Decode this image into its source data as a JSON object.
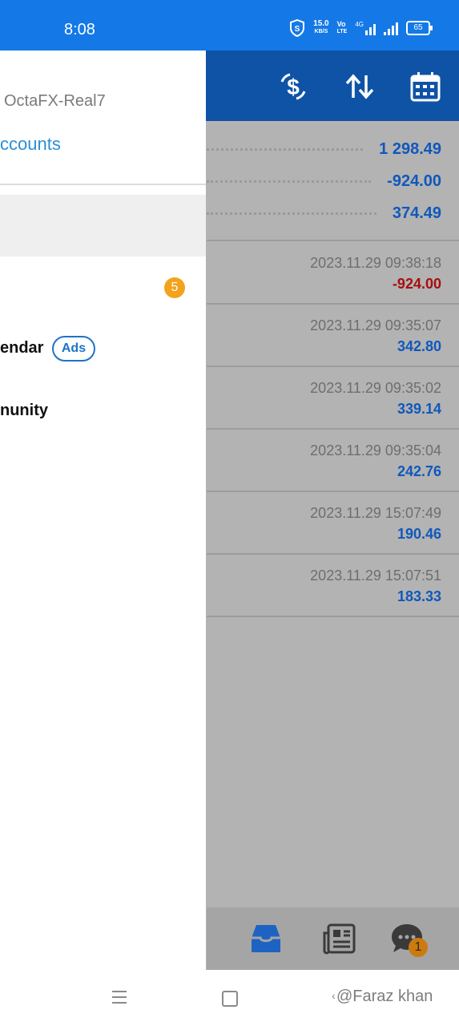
{
  "status_bar": {
    "time": "8:08",
    "network_speed_value": "15.0",
    "network_speed_unit": "KB/S",
    "volte_top": "Vo",
    "volte_bottom": "LTE",
    "network_type": "4G",
    "battery": "65"
  },
  "header_icons": [
    "currency-exchange-icon",
    "sort-icon",
    "calendar-icon"
  ],
  "summary": [
    {
      "value": "1 298.49"
    },
    {
      "value": "-924.00"
    },
    {
      "value": "374.49"
    }
  ],
  "deals": [
    {
      "datetime": "2023.11.29 09:38:18",
      "profit": "-924.00",
      "negative": true
    },
    {
      "datetime": "2023.11.29 09:35:07",
      "profit": "342.80",
      "negative": false
    },
    {
      "datetime": "2023.11.29 09:35:02",
      "profit": "339.14",
      "negative": false
    },
    {
      "datetime": "2023.11.29 09:35:04",
      "profit": "242.76",
      "negative": false
    },
    {
      "datetime": "2023.11.29 15:07:49",
      "profit": "190.46",
      "negative": false
    },
    {
      "datetime": "2023.11.29 15:07:51",
      "profit": "183.33",
      "negative": false
    }
  ],
  "bottom_nav": {
    "icons": [
      "inbox-icon",
      "news-icon",
      "chat-icon"
    ],
    "chat_badge": "1"
  },
  "drawer": {
    "account_name": "OctaFX-Real7",
    "accounts_link": "ccounts",
    "mailbox_badge": "5",
    "calendar_label": "endar",
    "ads_badge": "Ads",
    "community_label": "nunity"
  },
  "watermark": "@Faraz khan",
  "colors": {
    "status_bar": "#1479e6",
    "header": "#0f53a6",
    "positive": "#1058bb",
    "negative": "#a80e0e",
    "link": "#2b8fd6",
    "badge_orange": "#f2a31d"
  }
}
